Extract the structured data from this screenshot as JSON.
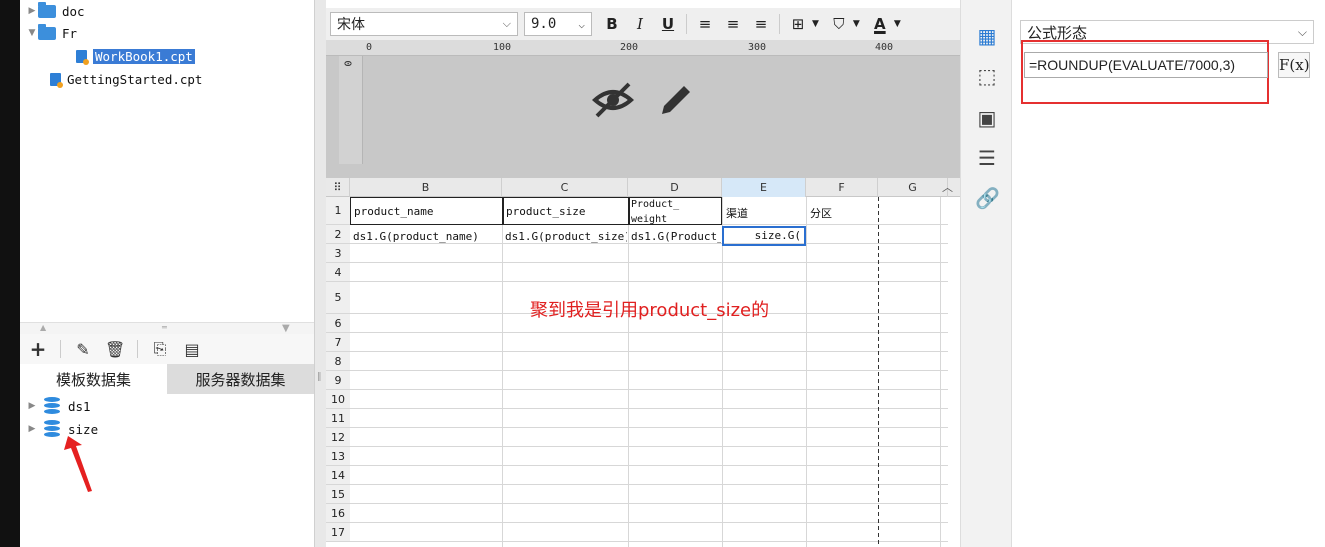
{
  "file_tree": {
    "items": [
      {
        "label": "doc",
        "type": "folder",
        "expanded": false
      },
      {
        "label": "Fr",
        "type": "folder",
        "expanded": true
      },
      {
        "label": "WorkBook1.cpt",
        "type": "file",
        "selected": true
      },
      {
        "label": "GettingStarted.cpt",
        "type": "file",
        "selected": false
      }
    ]
  },
  "dataset_toolbar": {
    "add": "+",
    "edit": "edit",
    "delete": "delete",
    "preview": "preview",
    "server": "server"
  },
  "dataset_tabs": [
    {
      "label": "模板数据集",
      "active": true
    },
    {
      "label": "服务器数据集",
      "active": false
    }
  ],
  "datasets": [
    {
      "label": "ds1"
    },
    {
      "label": "size"
    }
  ],
  "format_bar": {
    "font_name": "宋体",
    "font_size": "9.0",
    "bold": "B",
    "italic": "I",
    "underline": "U"
  },
  "ruler": {
    "ticks": [
      "0",
      "100",
      "200",
      "300",
      "400"
    ]
  },
  "vruler": {
    "tick": "0"
  },
  "grid": {
    "columns": [
      "B",
      "C",
      "D",
      "E",
      "F",
      "G"
    ],
    "rows": [
      "1",
      "2",
      "3",
      "4",
      "5",
      "6",
      "7",
      "8",
      "9",
      "10",
      "11",
      "12",
      "13",
      "14",
      "15",
      "16",
      "17"
    ],
    "row1": {
      "B": "product_name",
      "C": "product_size",
      "D_line1": "Product_",
      "D_line2": "weight",
      "E": "渠道",
      "F": "分区"
    },
    "row2": {
      "B": "ds1.G(product_name)",
      "C": "ds1.G(product_size)",
      "D": "ds1.G(Product_",
      "E": "size.G("
    },
    "annotation": "聚到我是引用product_size的"
  },
  "property_panel": {
    "select_value": "公式形态",
    "formula": "=ROUNDUP(EVALUATE/7000,3)",
    "fx_label": "F(x)"
  },
  "colors": {
    "accent": "#3a7bd5",
    "highlight": "#e53030"
  }
}
